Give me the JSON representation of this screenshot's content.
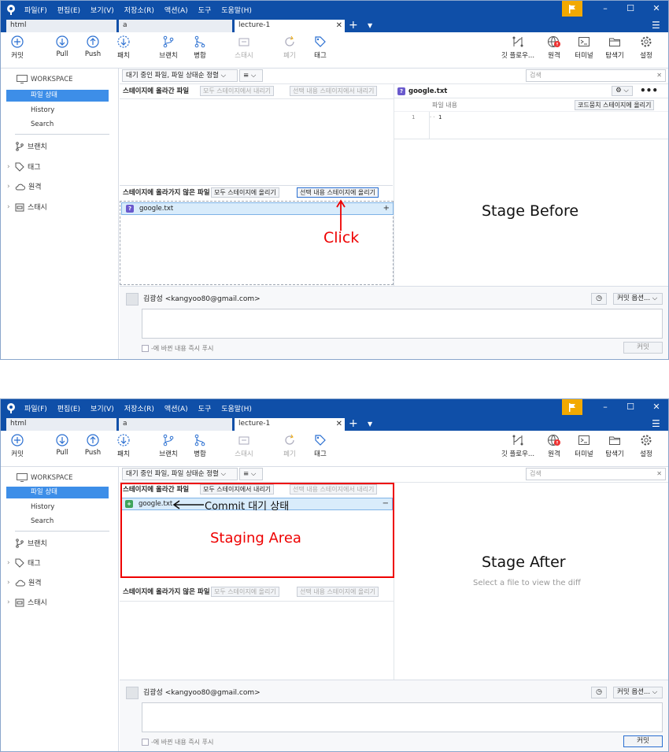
{
  "menu": [
    "파일(F)",
    "편집(E)",
    "보기(V)",
    "저장소(R)",
    "액션(A)",
    "도구",
    "도움말(H)"
  ],
  "tabs": [
    {
      "label": "html"
    },
    {
      "label": "a"
    },
    {
      "label": "lecture-1"
    }
  ],
  "toolbar": {
    "commit": "커밋",
    "pull": "Pull",
    "push": "Push",
    "fetch": "패치",
    "branch": "브랜치",
    "merge": "병합",
    "stash": "스태시",
    "discard": "폐기",
    "tag": "태그",
    "git_flow": "깃 플로우...",
    "remote": "원격",
    "terminal": "터미널",
    "explorer": "탐색기",
    "settings": "설정"
  },
  "sidebar": {
    "workspace": "WORKSPACE",
    "file_status": "파일 상태",
    "history": "History",
    "search": "Search",
    "branches": "브랜치",
    "tags": "태그",
    "remotes": "원격",
    "stashes": "스태시"
  },
  "filter": {
    "pending": "대기 중인 파일, 파일 상태순 정렬",
    "view": "≡",
    "search_placeholder": "검색"
  },
  "staged": {
    "title": "스테이지에 올라간 파일",
    "unstage_all": "모두 스테이지에서 내리기",
    "unstage_selected": "선택 내용 스테이지에서 내리기"
  },
  "unstaged": {
    "title": "스테이지에 올라가지 않은 파일",
    "stage_all": "모두 스테이지에 올리기",
    "stage_selected": "선택 내용 스테이지에 올리기"
  },
  "file": {
    "name": "google.txt"
  },
  "diff": {
    "file_name": "google.txt",
    "file_content_label": "파일 내용",
    "stage_hunk": "코드뭉치 스테이지에 올리기",
    "line_no": "1",
    "line_text": "1",
    "empty_message": "Select a file to view the diff"
  },
  "commit": {
    "author": "김광성 <kangyoo80@gmail.com>",
    "options": "커밋 옵션...",
    "push_immediately": "-에 바뀐 내용 즉시 푸시",
    "button": "커밋"
  },
  "annotations": {
    "click": "Click",
    "stage_before": "Stage Before",
    "stage_after": "Stage After",
    "commit_waiting": "Commit 대기 상태",
    "staging_area": "Staging Area"
  },
  "colors": {
    "title_bar": "#0f4fa8",
    "accent": "#3d8ee8",
    "annotation": "#e00000",
    "flag": "#f2a900"
  }
}
